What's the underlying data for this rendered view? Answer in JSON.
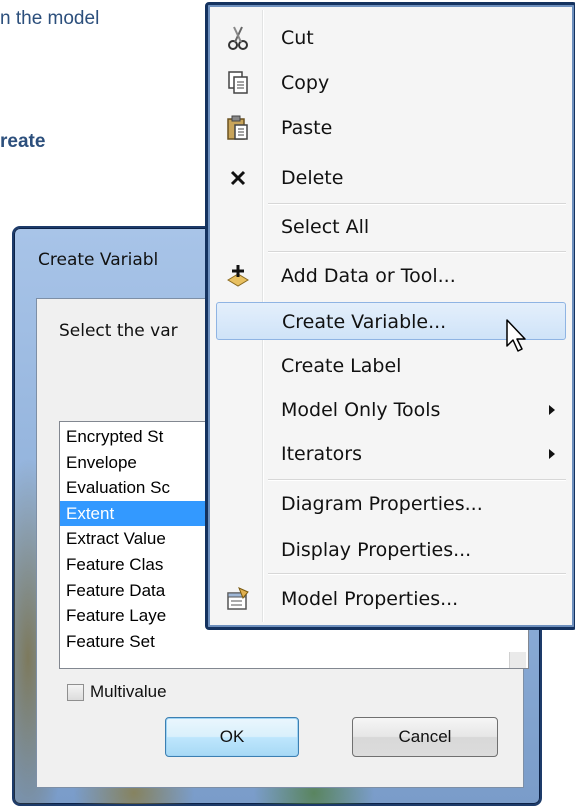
{
  "background_text": {
    "line1": "n the model",
    "line2": "reate"
  },
  "dialog": {
    "title": "Create Variabl",
    "prompt": "Select the var",
    "list_items": [
      "Encrypted St",
      "Envelope",
      "Evaluation Sc",
      "Extent",
      "Extract Value",
      "Feature Clas",
      "Feature Data",
      "Feature Laye",
      "Feature Set"
    ],
    "selected_item": "Extent",
    "multivalue_label": "Multivalue",
    "multivalue_checked": false,
    "ok_label": "OK",
    "cancel_label": "Cancel"
  },
  "context_menu": {
    "items": [
      {
        "label": "Cut",
        "icon": "scissors-icon"
      },
      {
        "label": "Copy",
        "icon": "copy-icon"
      },
      {
        "label": "Paste",
        "icon": "paste-icon"
      },
      {
        "label": "Delete",
        "icon": "delete-x-icon"
      },
      {
        "label": "Select All",
        "icon": ""
      },
      {
        "label": "Add Data or Tool...",
        "icon": "add-data-icon"
      },
      {
        "label": "Create Variable...",
        "icon": ""
      },
      {
        "label": "Create Label",
        "icon": ""
      },
      {
        "label": "Model Only Tools",
        "icon": "",
        "submenu": true
      },
      {
        "label": "Iterators",
        "icon": "",
        "submenu": true
      },
      {
        "label": "Diagram Properties...",
        "icon": ""
      },
      {
        "label": "Display Properties...",
        "icon": ""
      },
      {
        "label": "Model Properties...",
        "icon": "model-properties-icon"
      }
    ],
    "highlighted": "Create Variable..."
  },
  "colors": {
    "selection": "#3399ff",
    "menu_highlight": "#cfe3f8",
    "document_text": "#2c4f7c"
  }
}
